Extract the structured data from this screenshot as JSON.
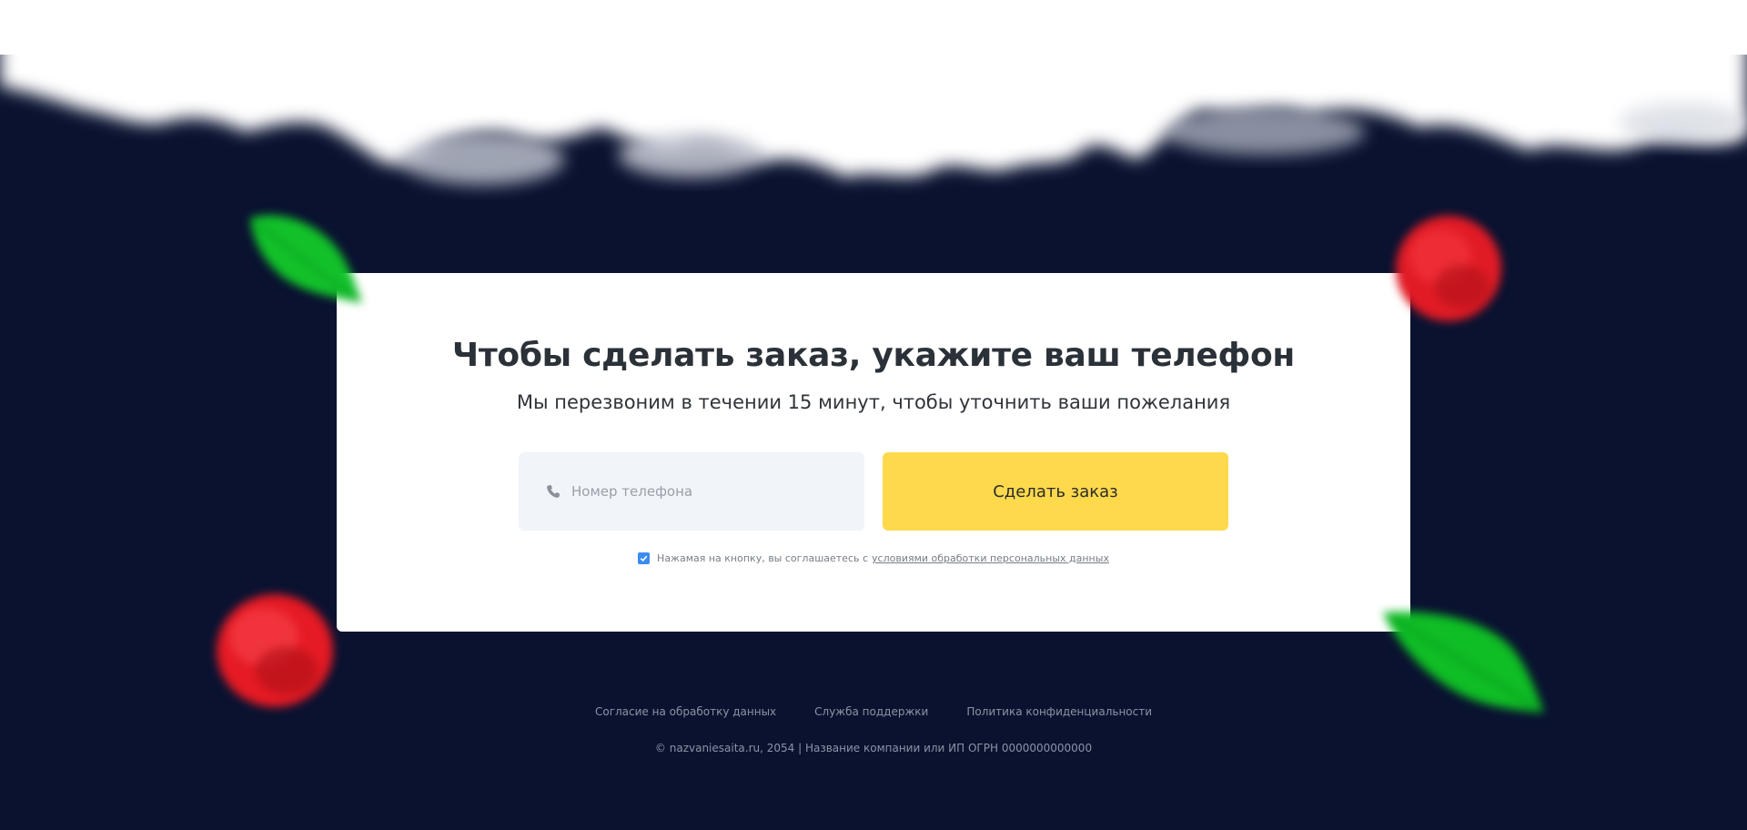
{
  "form": {
    "title": "Чтобы сделать заказ, укажите ваш телефон",
    "subtitle": "Мы перезвоним в течении 15 минут, чтобы уточнить ваши пожелания",
    "phone_placeholder": "Номер телефона",
    "phone_value": "",
    "submit_label": "Сделать заказ",
    "consent_checked": true,
    "consent_text": "Нажамая на кнопку, вы соглашаетесь с",
    "consent_link": "условиями обработки персональных данных"
  },
  "footer": {
    "links": [
      {
        "label": "Согласие на обработку данных"
      },
      {
        "label": "Служба поддержки"
      },
      {
        "label": "Политика конфиденциальности"
      }
    ],
    "copyright": "© nazvaniesaita.ru, 2054 | Название компании или ИП ОГРН 0000000000000"
  },
  "colors": {
    "background": "#0a1230",
    "card": "#ffffff",
    "button": "#fed94c",
    "input_bg": "#f1f4f9",
    "checkbox": "#3b8cf0"
  },
  "icons": {
    "phone": "phone-icon",
    "checkbox": "checkmark-icon"
  }
}
